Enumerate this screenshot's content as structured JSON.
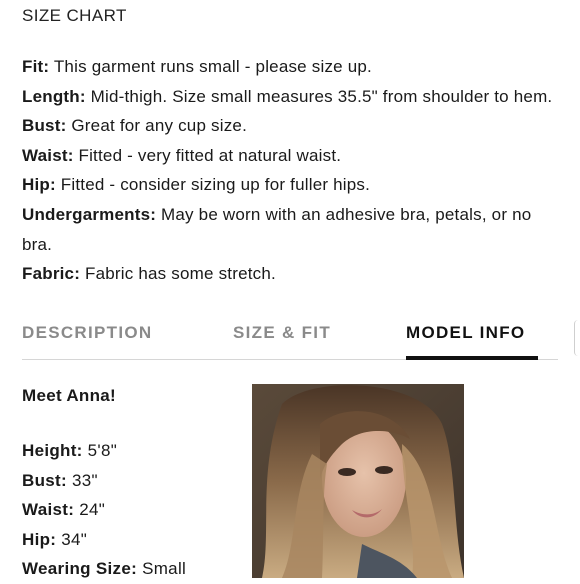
{
  "size_chart_link": "SIZE CHART",
  "details": {
    "fit": {
      "label": "Fit:",
      "text": " This garment runs small - please size up."
    },
    "length": {
      "label": "Length:",
      "text": " Mid-thigh. Size small measures 35.5\" from shoulder to hem."
    },
    "bust": {
      "label": "Bust:",
      "text": " Great for any cup size."
    },
    "waist": {
      "label": "Waist:",
      "text": " Fitted - very fitted at natural waist."
    },
    "hip": {
      "label": "Hip:",
      "text": " Fitted - consider sizing up for fuller hips."
    },
    "undergarments": {
      "label": "Undergarments:",
      "text": " May be worn with an adhesive bra, petals, or no bra."
    },
    "fabric": {
      "label": "Fabric:",
      "text": " Fabric has some stretch."
    }
  },
  "tabs": [
    {
      "label": "DESCRIPTION",
      "active": false
    },
    {
      "label": "SIZE & FIT",
      "active": false
    },
    {
      "label": "MODEL INFO",
      "active": true
    }
  ],
  "model_info": {
    "heading": "Meet Anna!",
    "height": {
      "label": "Height:",
      "value": " 5'8\""
    },
    "bust": {
      "label": "Bust:",
      "value": " 33\""
    },
    "waist": {
      "label": "Waist:",
      "value": " 24\""
    },
    "hip": {
      "label": "Hip:",
      "value": " 34\""
    },
    "wearing_size": {
      "label": "Wearing Size:",
      "value": " Small"
    }
  },
  "colors": {
    "active_tab": "#111111",
    "inactive_tab": "#8a8a8a",
    "text": "#1a1a1a"
  }
}
